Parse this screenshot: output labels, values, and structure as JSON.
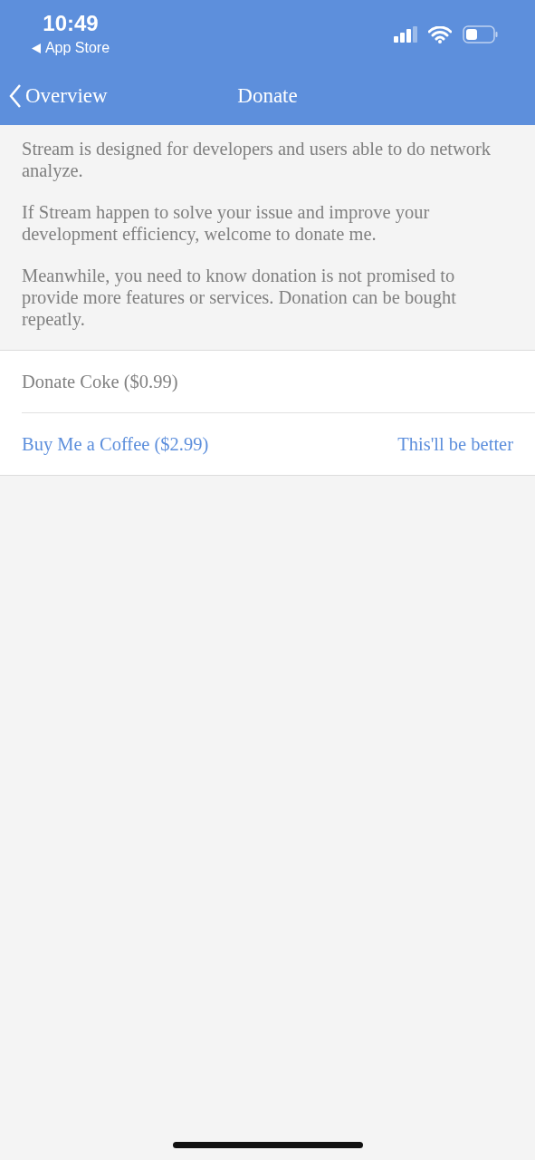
{
  "status_bar": {
    "time": "10:49",
    "back_app": "App Store"
  },
  "nav": {
    "back": "Overview",
    "title": "Donate"
  },
  "paragraphs": [
    "Stream is designed for developers and users able to do network analyze.",
    "If Stream happen to solve your issue and improve your development efficiency, welcome to donate me.",
    "Meanwhile, you need to know donation is not promised to provide more features or services. Donation can be bought repeatly."
  ],
  "options": [
    {
      "label": "Donate Coke ($0.99)",
      "highlighted": false
    },
    {
      "label": "Buy Me a Coffee ($2.99)",
      "highlighted": true,
      "detail": "This'll be better"
    }
  ]
}
